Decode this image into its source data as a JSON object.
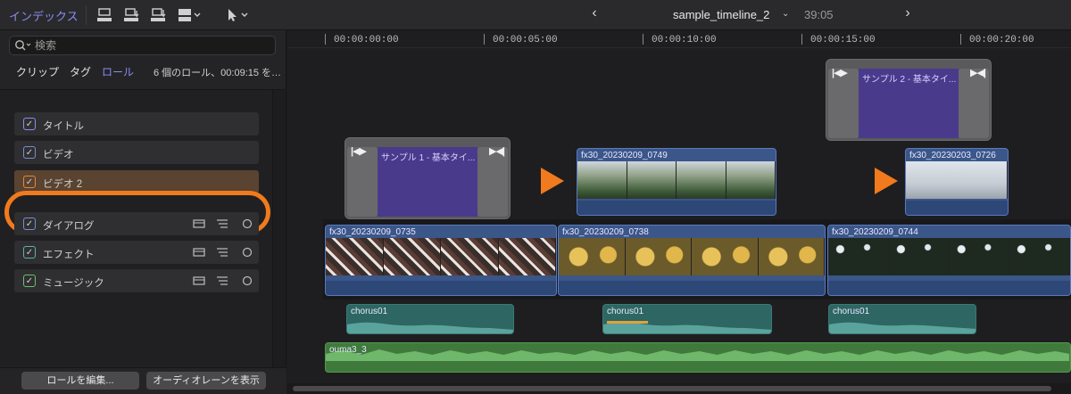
{
  "toolbar": {
    "index_label": "インデックス",
    "project_name": "sample_timeline_2",
    "duration": "39:05",
    "icons": [
      "clip-append-icon",
      "clip-insert-icon",
      "clip-connect-icon",
      "clip-overwrite-icon",
      "select-tool-icon"
    ]
  },
  "index": {
    "search_placeholder": "検索",
    "tabs": [
      {
        "label": "クリップ",
        "active": false
      },
      {
        "label": "タグ",
        "active": false
      },
      {
        "label": "ロール",
        "active": true
      }
    ],
    "summary": "6 個のロール、00:09:15 を…",
    "roles": [
      {
        "label": "タイトル",
        "checked": true
      },
      {
        "label": "ビデオ",
        "checked": true
      },
      {
        "label": "ビデオ 2",
        "checked": true,
        "highlighted": true
      },
      {
        "label": "ダイアログ",
        "checked": true
      },
      {
        "label": "エフェクト",
        "checked": true
      },
      {
        "label": "ミュージック",
        "checked": true
      }
    ],
    "buttons": {
      "edit_roles": "ロールを編集...",
      "show_audio_lanes": "オーディオレーンを表示"
    }
  },
  "timeline": {
    "ruler": [
      "00:00:00:00",
      "00:00:05:00",
      "00:00:10:00",
      "00:00:15:00",
      "00:00:20:00"
    ],
    "titles": [
      {
        "label": "サンプル 2 - 基本タイ..."
      },
      {
        "label": "サンプル 1 - 基本タイ..."
      }
    ],
    "connected_clips": [
      {
        "label": "fx30_20230209_0749"
      },
      {
        "label": "fx30_20230203_0726"
      }
    ],
    "primary_clips": [
      {
        "label": "fx30_20230209_0735"
      },
      {
        "label": "fx30_20230209_0738"
      },
      {
        "label": "fx30_20230209_0744"
      }
    ],
    "audio_clips": [
      {
        "label": "chorus01"
      },
      {
        "label": "chorus01"
      },
      {
        "label": "chorus01"
      }
    ],
    "music_clip": {
      "label": "ouma3_3"
    }
  },
  "colors": {
    "accent": "#8a8cf5",
    "highlight": "#f07a1d",
    "video_clip": "#3b5689",
    "title_clip": "#4a3a8c",
    "audio_clip": "#2d6663",
    "music_clip": "#3f7a3c"
  }
}
